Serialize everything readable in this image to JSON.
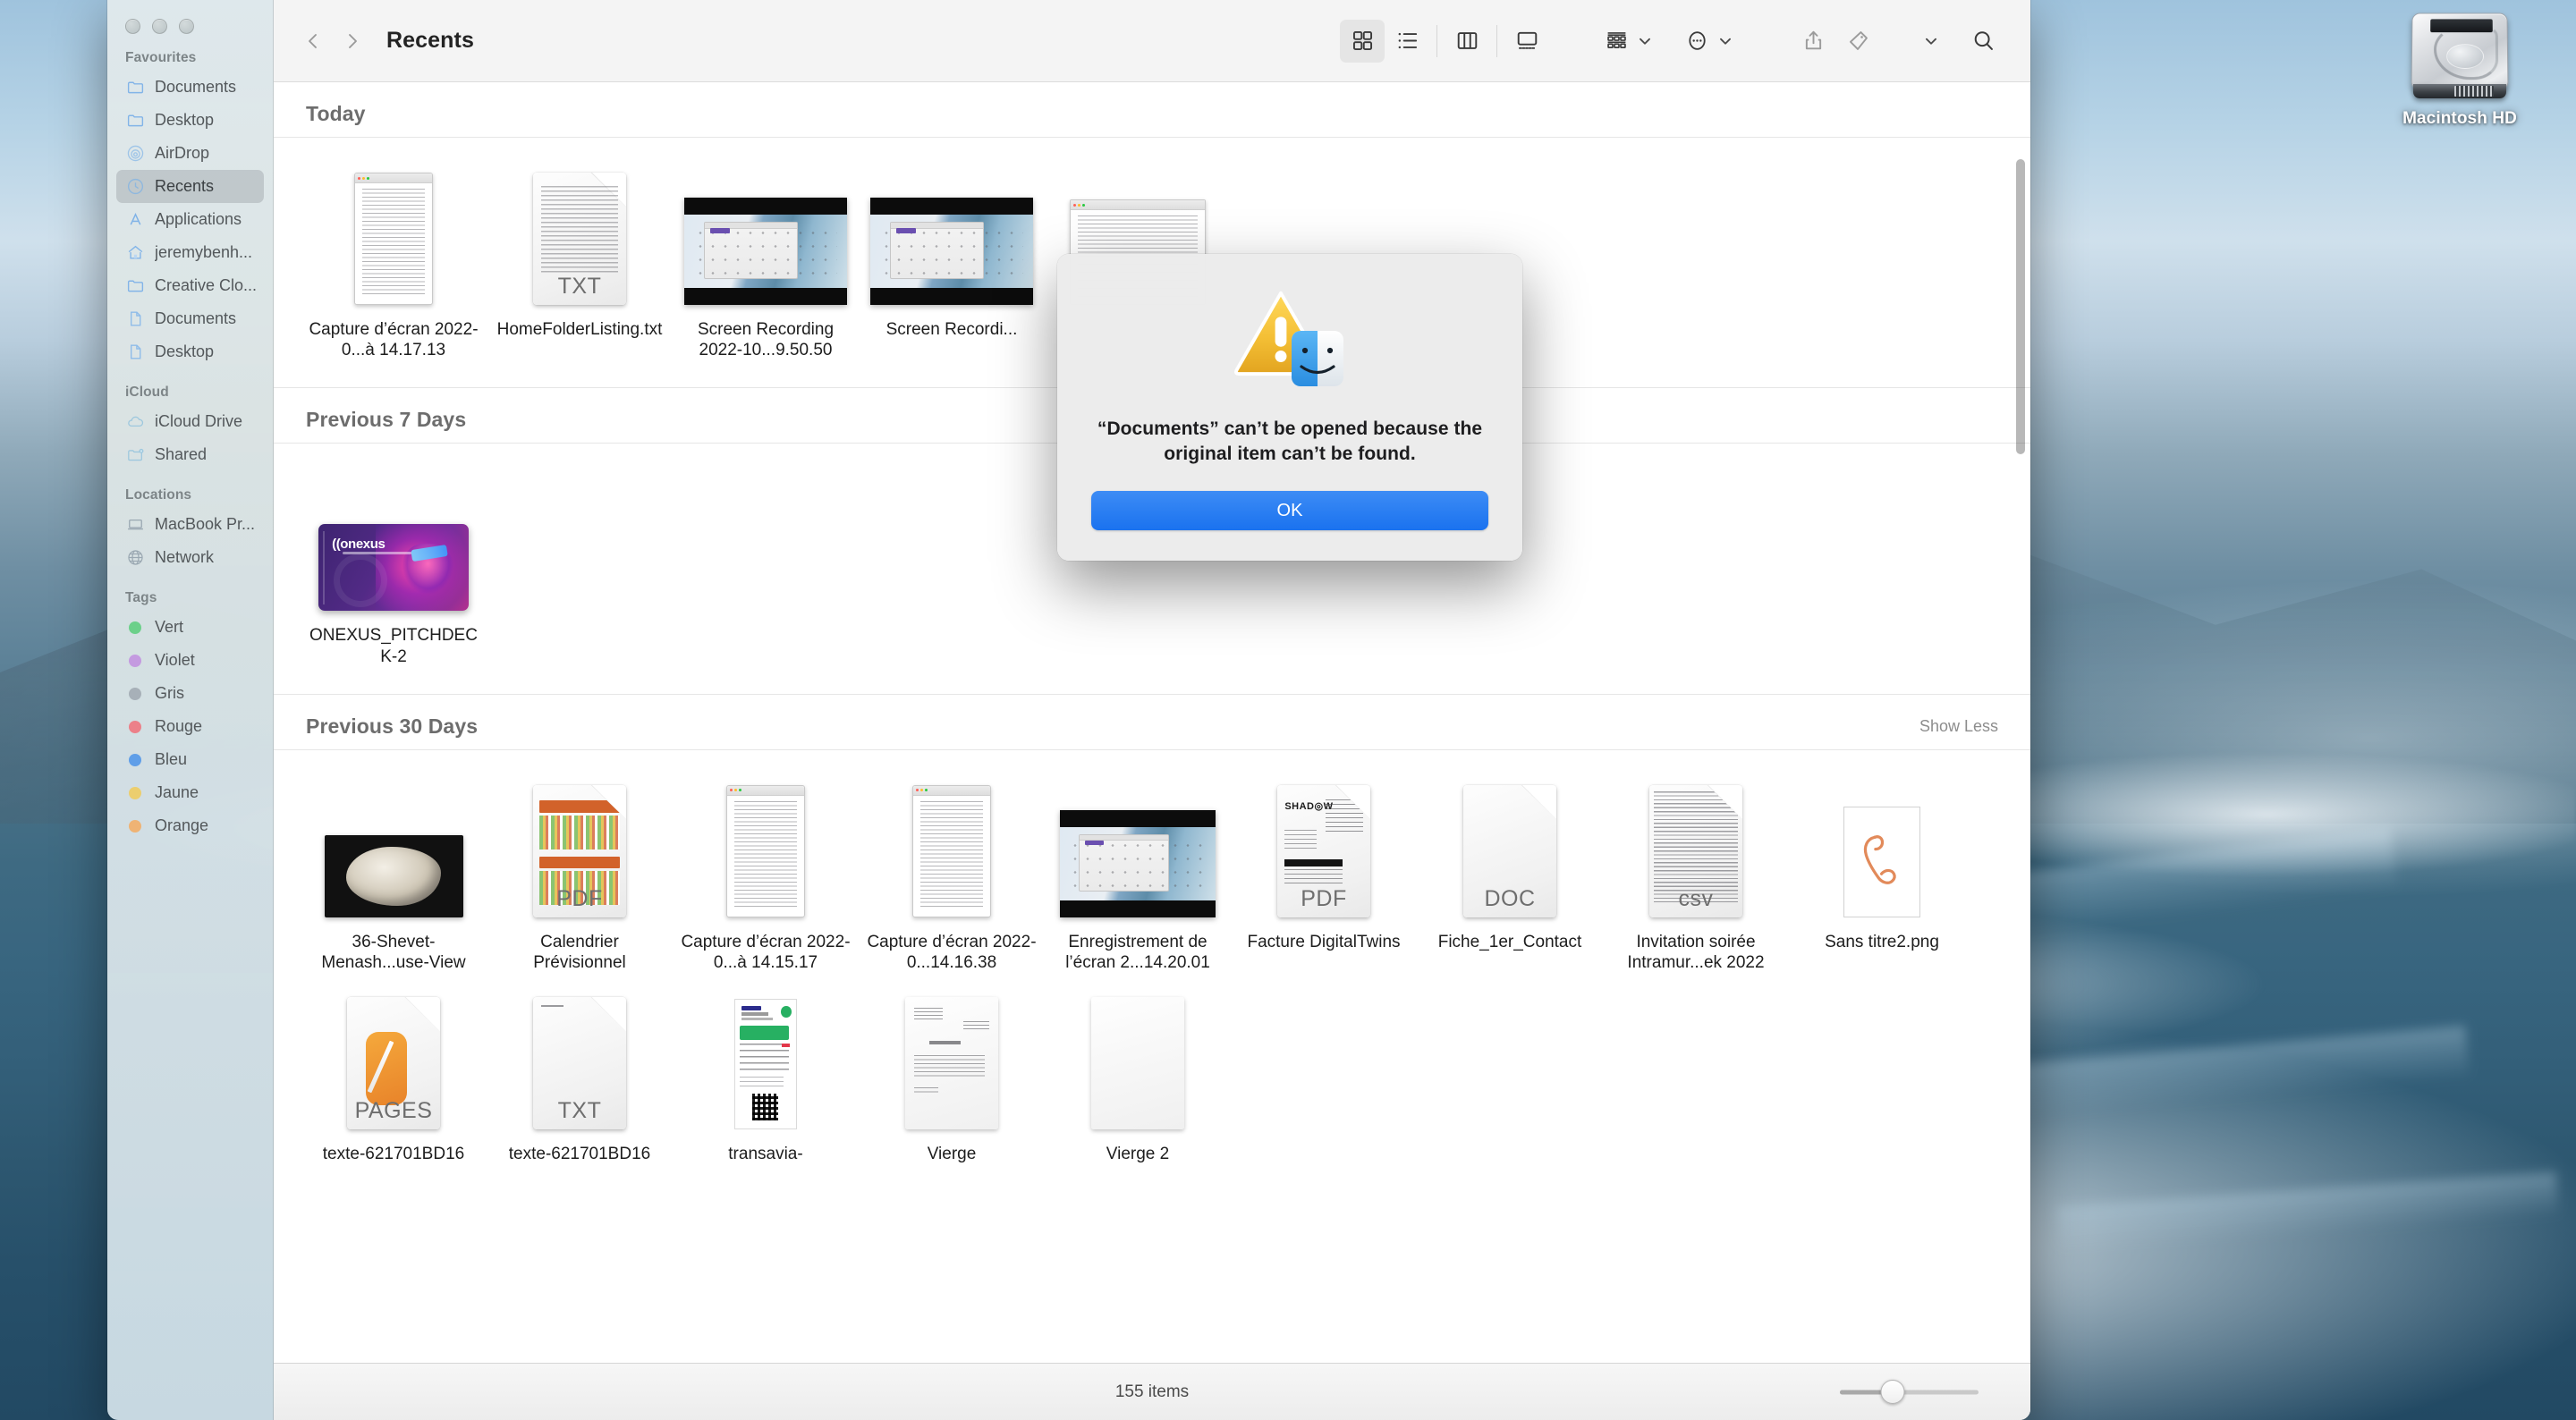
{
  "desktop": {
    "icons": [
      {
        "name": "Macintosh HD",
        "type": "hard-drive"
      }
    ]
  },
  "window": {
    "title": "Recents",
    "traffic_lights": [
      "close",
      "minimize",
      "zoom"
    ],
    "nav": {
      "back": "Back",
      "forward": "Forward"
    },
    "toolbar_buttons": [
      {
        "name": "icon-view",
        "label": "Icon View",
        "selected": true
      },
      {
        "name": "list-view",
        "label": "List View",
        "selected": false
      },
      {
        "name": "column-view",
        "label": "Column View",
        "selected": false
      },
      {
        "name": "gallery-view",
        "label": "Gallery View",
        "selected": false
      },
      {
        "name": "group-by",
        "label": "Group By",
        "selected": false
      },
      {
        "name": "action-menu",
        "label": "Action",
        "selected": false
      },
      {
        "name": "share",
        "label": "Share",
        "selected": false
      },
      {
        "name": "tags",
        "label": "Edit Tags",
        "selected": false
      },
      {
        "name": "more",
        "label": "More",
        "selected": false
      },
      {
        "name": "search",
        "label": "Search",
        "selected": false
      }
    ],
    "status": {
      "item_count": "155 items",
      "zoom_value": 38
    }
  },
  "sidebar": {
    "sections": [
      {
        "title": "Favourites",
        "items": [
          {
            "label": "Documents",
            "icon": "folder-icon",
            "active": false
          },
          {
            "label": "Desktop",
            "icon": "folder-icon",
            "active": false
          },
          {
            "label": "AirDrop",
            "icon": "airdrop-icon",
            "active": false
          },
          {
            "label": "Recents",
            "icon": "clock-icon",
            "active": true
          },
          {
            "label": "Applications",
            "icon": "applications-icon",
            "active": false
          },
          {
            "label": "jeremybenh...",
            "icon": "home-icon",
            "active": false
          },
          {
            "label": "Creative Clo...",
            "icon": "folder-icon",
            "active": false
          },
          {
            "label": "Documents",
            "icon": "document-icon",
            "active": false
          },
          {
            "label": "Desktop",
            "icon": "document-icon",
            "active": false
          }
        ]
      },
      {
        "title": "iCloud",
        "items": [
          {
            "label": "iCloud Drive",
            "icon": "cloud-icon",
            "active": false
          },
          {
            "label": "Shared",
            "icon": "shared-folder-icon",
            "active": false
          }
        ]
      },
      {
        "title": "Locations",
        "items": [
          {
            "label": "MacBook Pr...",
            "icon": "laptop-icon",
            "active": false
          },
          {
            "label": "Network",
            "icon": "globe-icon",
            "active": false
          }
        ]
      },
      {
        "title": "Tags",
        "items": [
          {
            "label": "Vert",
            "icon": "tag-dot",
            "color": "#6cd08a",
            "active": false
          },
          {
            "label": "Violet",
            "icon": "tag-dot",
            "color": "#c49ae0",
            "active": false
          },
          {
            "label": "Gris",
            "icon": "tag-dot",
            "color": "#a7b0b8",
            "active": false
          },
          {
            "label": "Rouge",
            "icon": "tag-dot",
            "color": "#ec8089",
            "active": false
          },
          {
            "label": "Bleu",
            "icon": "tag-dot",
            "color": "#5f9ee8",
            "active": false
          },
          {
            "label": "Jaune",
            "icon": "tag-dot",
            "color": "#ecce6e",
            "active": false
          },
          {
            "label": "Orange",
            "icon": "tag-dot",
            "color": "#efb374",
            "active": false
          }
        ]
      }
    ]
  },
  "groups": [
    {
      "title": "Today",
      "show_toggle": "",
      "files": [
        {
          "name": "Capture d’écran 2022-0...à 14.17.13",
          "thumb": "screenshot-window"
        },
        {
          "name": "HomeFolderListing.txt",
          "thumb": "txt-page"
        },
        {
          "name": "Screen Recording 2022-10...9.50.50",
          "thumb": "video"
        },
        {
          "name": "Screen Recordi...",
          "thumb": "video"
        },
        {
          "name": "",
          "thumb": "screenshot-window"
        }
      ]
    },
    {
      "title": "Previous 7 Days",
      "show_toggle": "",
      "files": [
        {
          "name": "ONEXUS_PITCHDECK-2",
          "thumb": "onexus-card"
        }
      ]
    },
    {
      "title": "Previous 30 Days",
      "show_toggle": "Show Less",
      "files": [
        {
          "name": "36-Shevet-Menash...use-View",
          "thumb": "stone-photo"
        },
        {
          "name": "Calendrier Prévisionnel",
          "thumb": "calendar-pdf",
          "ext": "PDF"
        },
        {
          "name": "Capture d’écran 2022-0...à 14.15.17",
          "thumb": "screenshot-window"
        },
        {
          "name": "Capture d’écran 2022-0...14.16.38",
          "thumb": "screenshot-window"
        },
        {
          "name": "Enregistrement de l’écran 2...14.20.01",
          "thumb": "video"
        },
        {
          "name": "Facture DigitalTwins",
          "thumb": "facture-pdf",
          "ext": "PDF"
        },
        {
          "name": "Fiche_1er_Contact",
          "thumb": "blank-page",
          "ext": "DOC"
        },
        {
          "name": "Invitation soirée Intramur...ek 2022",
          "thumb": "csv-page",
          "ext": "csv"
        },
        {
          "name": "Sans titre2.png",
          "thumb": "phone-drawing"
        },
        {
          "name": "texte-621701BD16",
          "thumb": "pages-page",
          "ext": "PAGES"
        },
        {
          "name": "texte-621701BD16",
          "thumb": "txt-page",
          "ext": "TXT"
        },
        {
          "name": "transavia-",
          "thumb": "ticket"
        },
        {
          "name": "Vierge",
          "thumb": "letter-doc"
        },
        {
          "name": "Vierge 2",
          "thumb": "blank-doc"
        }
      ]
    }
  ],
  "alert": {
    "icon": "warning-triangle-finder-icon",
    "message": "“Documents” can’t be opened because the original item can’t be found.",
    "ok_label": "OK",
    "accent_color": "#1a72ef"
  }
}
